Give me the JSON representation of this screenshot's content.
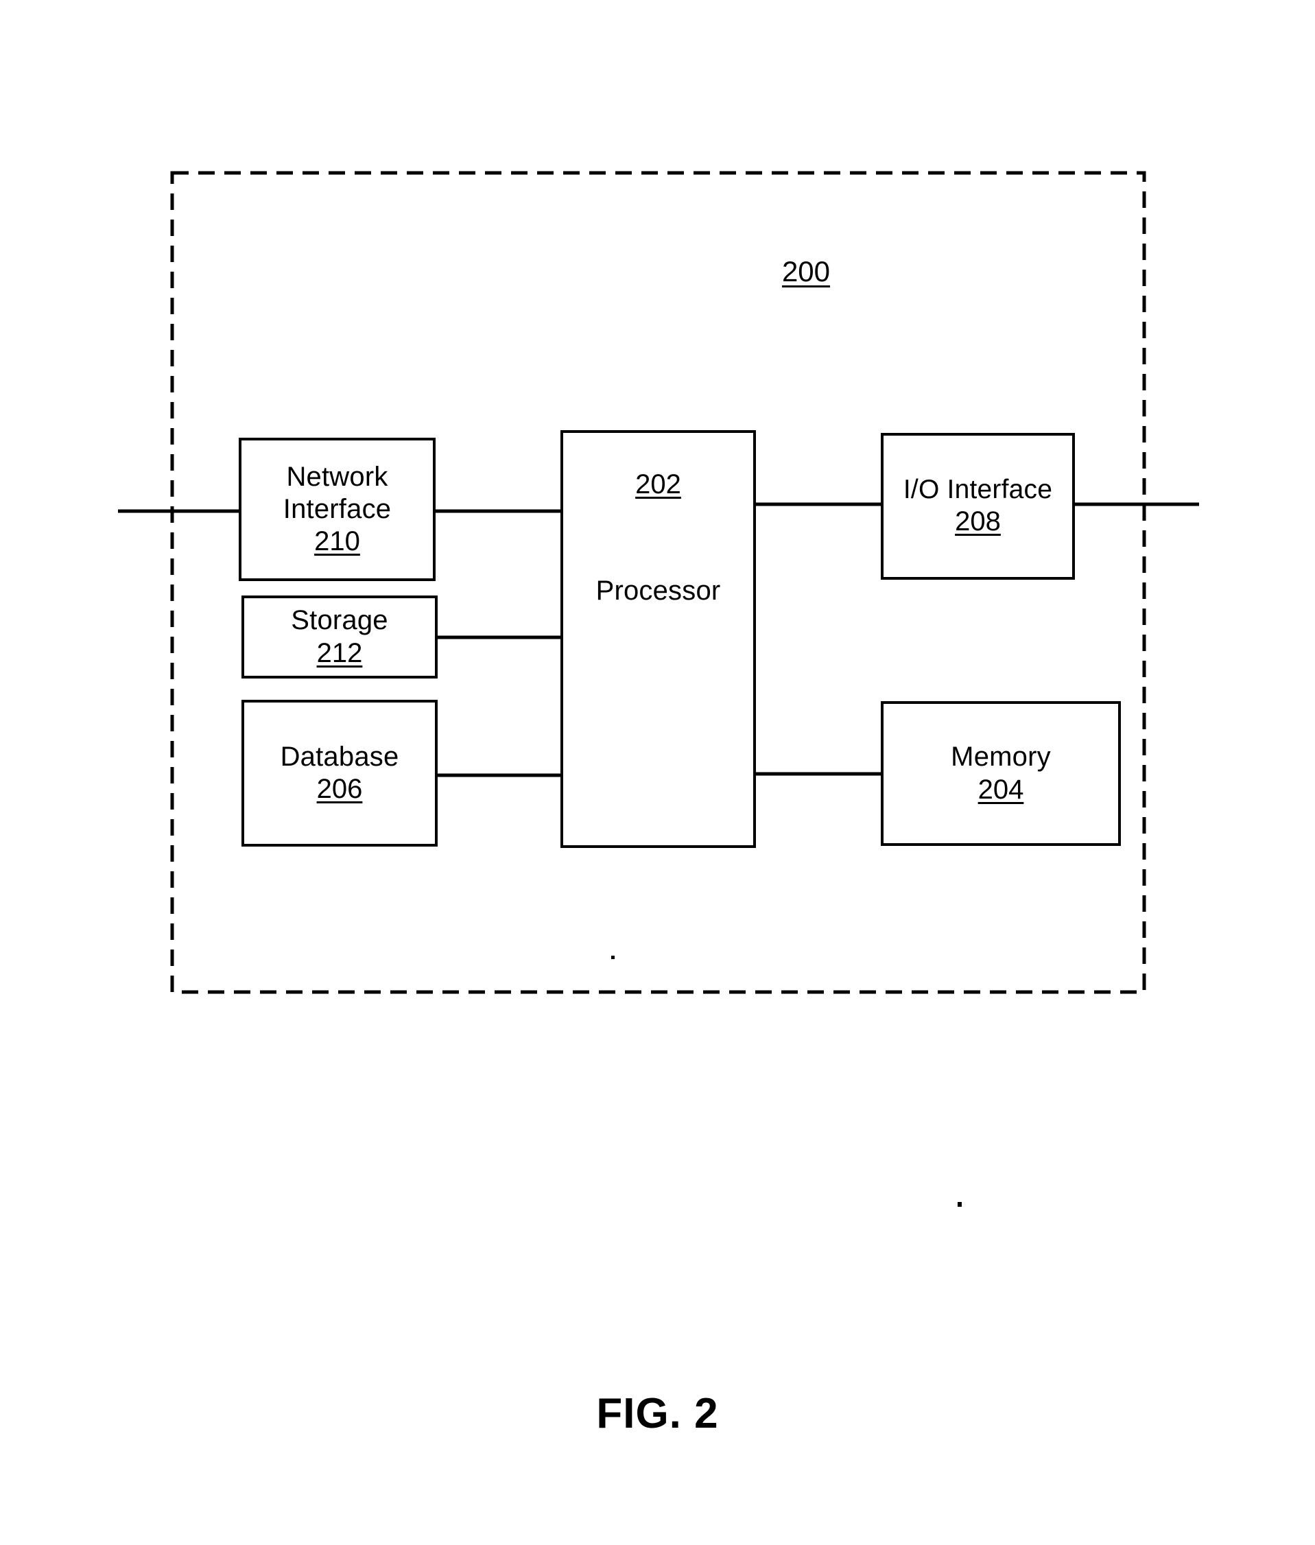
{
  "figure": {
    "caption": "FIG. 2",
    "system_reference": "200",
    "boundary_style": "dashed",
    "line_color": "#000000",
    "background_color": "#ffffff"
  },
  "nodes": [
    {
      "id": "network-interface",
      "label": "Network Interface",
      "label_line_1": "Network",
      "label_line_2": "Interface",
      "reference": "210"
    },
    {
      "id": "storage",
      "label": "Storage",
      "reference": "212"
    },
    {
      "id": "database",
      "label": "Database",
      "reference": "206"
    },
    {
      "id": "processor",
      "label": "Processor",
      "reference": "202"
    },
    {
      "id": "io-interface",
      "label": "I/O Interface",
      "reference": "208"
    },
    {
      "id": "memory",
      "label": "Memory",
      "reference": "204"
    }
  ],
  "connections": [
    {
      "from": "external-left",
      "to": "network-interface"
    },
    {
      "from": "network-interface",
      "to": "processor"
    },
    {
      "from": "storage",
      "to": "processor"
    },
    {
      "from": "database",
      "to": "processor"
    },
    {
      "from": "processor",
      "to": "io-interface"
    },
    {
      "from": "processor",
      "to": "memory"
    },
    {
      "from": "io-interface",
      "to": "external-right"
    }
  ]
}
